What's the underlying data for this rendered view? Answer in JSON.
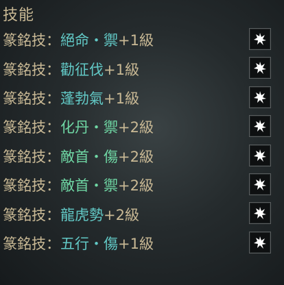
{
  "panel": {
    "title": "技能",
    "enchant_button_icon": "sword-flame-icon",
    "rows": [
      {
        "prefix": "篆銘技：",
        "skill": "絕命・禦",
        "suffix": "+1級",
        "skill_color": "#62c9c6"
      },
      {
        "prefix": "篆銘技：",
        "skill": "勸征伐",
        "suffix": "+1級",
        "skill_color": "#62c9c6"
      },
      {
        "prefix": "篆銘技：",
        "skill": "蓬勃氣",
        "suffix": "+1級",
        "skill_color": "#62c9c6"
      },
      {
        "prefix": "篆銘技：",
        "skill": "化丹・禦",
        "suffix": "+2級",
        "skill_color": "#6fd7a4"
      },
      {
        "prefix": "篆銘技：",
        "skill": "敵首・傷",
        "suffix": "+2級",
        "skill_color": "#6fd7a4"
      },
      {
        "prefix": "篆銘技：",
        "skill": "敵首・禦",
        "suffix": "+2級",
        "skill_color": "#6fd7a4"
      },
      {
        "prefix": "篆銘技：",
        "skill": "龍虎勢",
        "suffix": "+2級",
        "skill_color": "#62c9c6"
      },
      {
        "prefix": "篆銘技：",
        "skill": "五行・傷",
        "suffix": "+1級",
        "skill_color": "#62c9c6"
      }
    ]
  }
}
